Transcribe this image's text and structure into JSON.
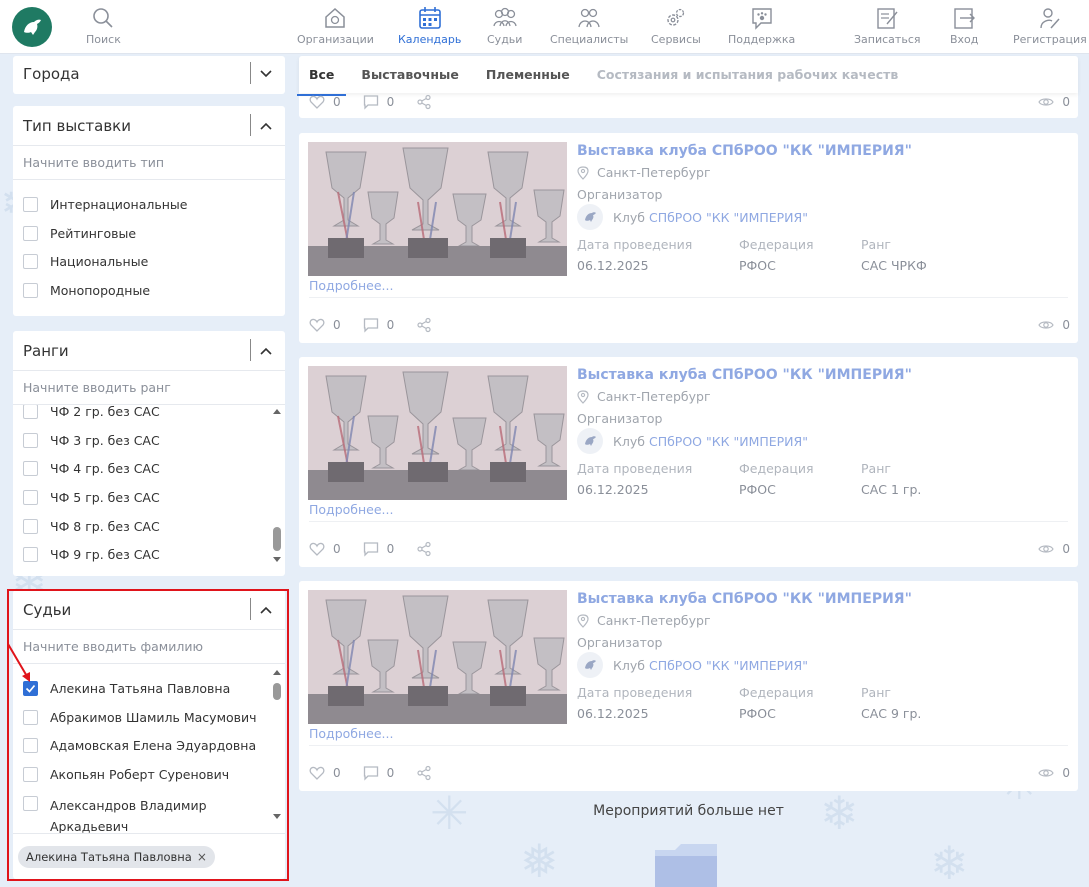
{
  "nav": {
    "search": "Поиск",
    "organizations": "Организации",
    "calendar": "Календарь",
    "judges": "Судьи",
    "specialists": "Специалисты",
    "services": "Сервисы",
    "support": "Поддержка",
    "signup": "Записаться",
    "login": "Вход",
    "register": "Регистрация",
    "active_color": "#2f6fd6"
  },
  "filters": {
    "cities": {
      "title": "Города"
    },
    "show_type": {
      "title": "Тип выставки",
      "placeholder": "Начните вводить тип",
      "options": [
        "Интернациональные",
        "Рейтинговые",
        "Национальные",
        "Монопородные"
      ]
    },
    "ranks": {
      "title": "Ранги",
      "placeholder": "Начните вводить ранг",
      "options": [
        "ЧФ 2 гр. без САС",
        "ЧФ 3 гр. без САС",
        "ЧФ 4 гр. без САС",
        "ЧФ 5 гр. без САС",
        "ЧФ 8 гр. без САС",
        "ЧФ 9 гр. без САС"
      ]
    },
    "judges": {
      "title": "Судьи",
      "placeholder": "Начните вводить фамилию",
      "options": [
        {
          "name": "Алекина Татьяна Павловна",
          "checked": true
        },
        {
          "name": "Абракимов Шамиль Масумович",
          "checked": false
        },
        {
          "name": "Адамовская Елена Эдуардовна",
          "checked": false
        },
        {
          "name": "Акопьян Роберт Суренович",
          "checked": false
        },
        {
          "name": "Александров Владимир",
          "checked": false
        },
        {
          "name": "Аркадьевич",
          "checked": false
        }
      ],
      "selected_tag": "Алекина Татьяна Павловна",
      "tag_remove": "×"
    }
  },
  "tabs": [
    "Все",
    "Выставочные",
    "Племенные",
    "Состязания и испытания рабочих качеств"
  ],
  "top_stats": {
    "likes": "0",
    "comments": "0",
    "views": "0"
  },
  "events": [
    {
      "title": "Выставка клуба СПбРОО \"КК \"ИМПЕРИЯ\"",
      "city": "Санкт-Петербург",
      "organizer_label": "Организатор",
      "club_prefix": "Клуб ",
      "club_name": "СПбРОО \"КК \"ИМПЕРИЯ\"",
      "date_label": "Дата проведения",
      "date": "06.12.2025",
      "federation_label": "Федерация",
      "federation": "РФОС",
      "rank_label": "Ранг",
      "rank": "САС ЧРКФ",
      "more": "Подробнее...",
      "likes": "0",
      "comments": "0",
      "views": "0"
    },
    {
      "title": "Выставка клуба СПбРОО \"КК \"ИМПЕРИЯ\"",
      "city": "Санкт-Петербург",
      "organizer_label": "Организатор",
      "club_prefix": "Клуб ",
      "club_name": "СПбРОО \"КК \"ИМПЕРИЯ\"",
      "date_label": "Дата проведения",
      "date": "06.12.2025",
      "federation_label": "Федерация",
      "federation": "РФОС",
      "rank_label": "Ранг",
      "rank": "САС 1 гр.",
      "more": "Подробнее...",
      "likes": "0",
      "comments": "0",
      "views": "0"
    },
    {
      "title": "Выставка клуба СПбРОО \"КК \"ИМПЕРИЯ\"",
      "city": "Санкт-Петербург",
      "organizer_label": "Организатор",
      "club_prefix": "Клуб ",
      "club_name": "СПбРОО \"КК \"ИМПЕРИЯ\"",
      "date_label": "Дата проведения",
      "date": "06.12.2025",
      "federation_label": "Федерация",
      "federation": "РФОС",
      "rank_label": "Ранг",
      "rank": "САС 9 гр.",
      "more": "Подробнее...",
      "likes": "0",
      "comments": "0",
      "views": "0"
    }
  ],
  "no_more": "Мероприятий больше нет"
}
